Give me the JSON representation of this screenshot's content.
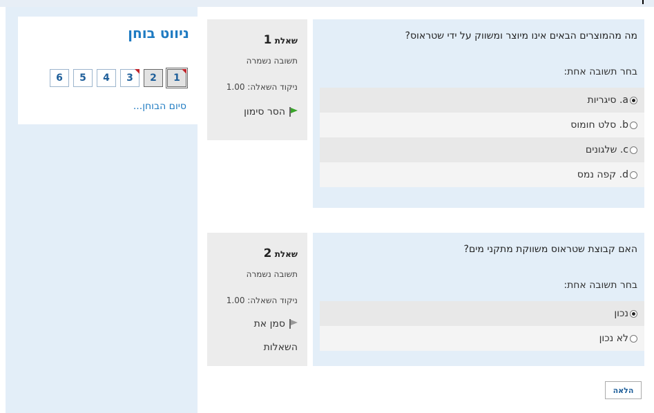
{
  "nav": {
    "title": "ניווט בוחן",
    "buttons": [
      {
        "label": "1",
        "state": "current-answered-flagged"
      },
      {
        "label": "2",
        "state": "answered"
      },
      {
        "label": "3",
        "state": "flagged"
      },
      {
        "label": "4",
        "state": "unanswered"
      },
      {
        "label": "5",
        "state": "unanswered"
      },
      {
        "label": "6",
        "state": "unanswered"
      }
    ],
    "finish_link": "סיום הבוחן..."
  },
  "questions": [
    {
      "title_prefix": "שאלת",
      "number": "1",
      "status": "תשובה נשמרה",
      "marks": "ניקוד השאלה: 1.00",
      "flag_label": "הסר סימון",
      "flag_color": "#3aa52b",
      "text": "מה מהמוצרים הבאים אינו מיוצר ומשווק על ידי שטראוס?",
      "prompt": "בחר תשובה אחת:",
      "options": [
        {
          "text": "a. סיגריות",
          "checked": true
        },
        {
          "text": "b. סלט חומוס",
          "checked": false
        },
        {
          "text": "c. שלגונים",
          "checked": false
        },
        {
          "text": "d. קפה נמס",
          "checked": false
        }
      ]
    },
    {
      "title_prefix": "שאלת",
      "number": "2",
      "status": "תשובה נשמרה",
      "marks": "ניקוד השאלה: 1.00",
      "flag_label_line1": "סמן את",
      "flag_label_line2": "השאלות",
      "flag_color": "#999999",
      "text": "האם קבוצת שטראוס משווקת מתקני מים?",
      "prompt": "בחר תשובה אחת:",
      "options": [
        {
          "text": "נכון",
          "checked": true
        },
        {
          "text": "לא נכון",
          "checked": false
        }
      ]
    }
  ],
  "next_button": "הלאה",
  "colors": {
    "accent": "#1f7bc2",
    "panel_bg": "#e3eef8",
    "info_bg": "#ececec",
    "flag_red": "#c0262d"
  }
}
